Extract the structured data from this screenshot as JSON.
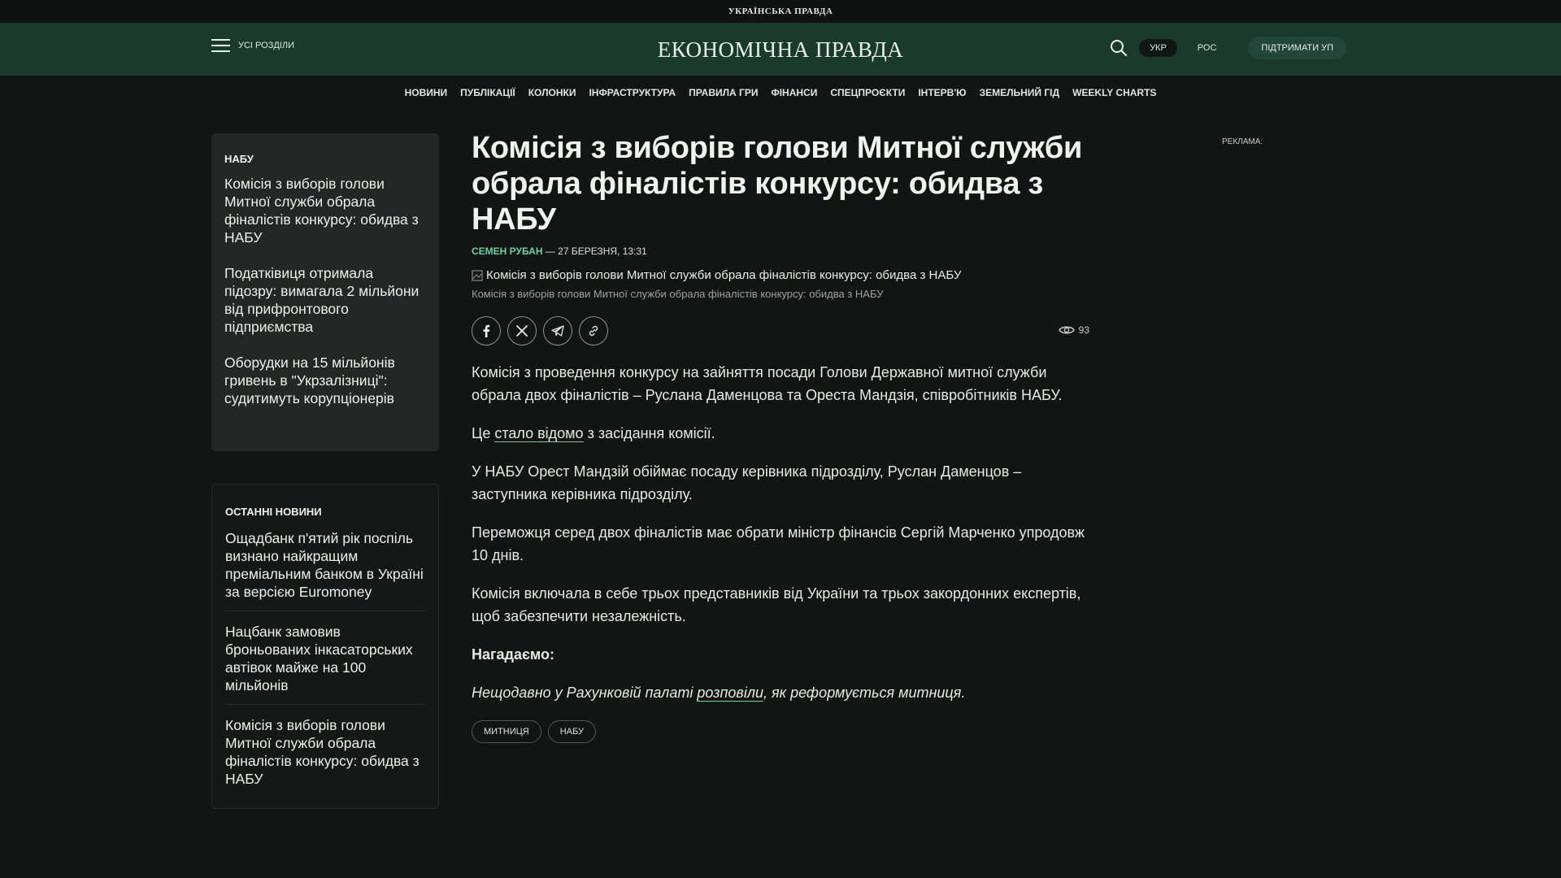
{
  "topstrip": {
    "brand": "УКРАЇНСЬКА ПРАВДА"
  },
  "header": {
    "menu_label": "УСІ РОЗДІЛИ",
    "logo": "ЕКОНОМІЧНА ПРАВДА",
    "lang_active": "УКР",
    "lang_other": "РОС",
    "support_label": "ПІДТРИМАТИ УП"
  },
  "nav": {
    "items": [
      "НОВИНИ",
      "ПУБЛІКАЦІЇ",
      "КОЛОНКИ",
      "ІНФРАСТРУКТУРА",
      "ПРАВИЛА ГРИ",
      "ФІНАНСИ",
      "СПЕЦПРОЄКТИ",
      "ІНТЕРВ'Ю",
      "ЗЕМЕЛЬНИЙ ГІД",
      "WEEKLY CHARTS"
    ]
  },
  "sidebar": {
    "topic_title": "НАБУ",
    "topic_items": [
      "Комісія з виборів голови Митної служби обрала фіналістів конкурсу: обидва з НАБУ",
      "Податківиця отримала підозру: вимагала 2 мільйони від прифронтового підприємства",
      "Оборудки на 15 мільйонів гривень в \"Укрзалізниці\": судитимуть корупціонерів"
    ],
    "latest_title": "ОСТАННІ НОВИНИ",
    "latest_items": [
      "Ощадбанк п'ятий рік поспіль визнано найкращим преміальним банком в Україні за версією Euromoney",
      "Нацбанк замовив броньованих інкасаторських автівок майже на 100 мільйонів",
      "Комісія з виборів голови Митної служби обрала фіналістів конкурсу: обидва з НАБУ"
    ]
  },
  "article": {
    "title": "Комісія з виборів голови Митної служби обрала фіналістів конкурсу: обидва з НАБУ",
    "author": "СЕМЕН РУБАН",
    "date": " — 27 БЕРЕЗНЯ, 13:31",
    "image_alt": "Комісія з виборів голови Митної служби обрала фіналістів конкурсу: обидва з НАБУ",
    "caption": "Комісія з виборів голови Митної служби обрала фіналістів конкурсу: обидва з НАБУ",
    "views": "93",
    "p1": "Комісія з проведення конкурсу на зайняття посади Голови Державної митної служби обрала двох фіналістів – Руслана Даменцова та Ореста Мандзія, співробітників НАБУ.",
    "p2_before": "Це ",
    "p2_link": "стало відомо",
    "p2_after": " з засідання комісії.",
    "p3": "У НАБУ Орест Мандзій обіймає посаду керівника підрозділу, Руслан Даменцов – заступника керівника підрозділу.",
    "p4": "Переможця серед двох фіналістів має обрати міністр фінансів Сергій Марченко упродовж 10 днів.",
    "p5": "Комісія включала в себе трьох представників від України та трьох закордонних експертів, щоб забезпечити незалежність.",
    "p6": "Нагадаємо:",
    "p7_before": "Нещодавно у Рахунковій палаті ",
    "p7_link": "розповіли",
    "p7_after": ", як реформується митниця.",
    "tags": [
      "МИТНИЦЯ",
      "НАБУ"
    ]
  },
  "ad": {
    "label": "РЕКЛАМА:"
  }
}
